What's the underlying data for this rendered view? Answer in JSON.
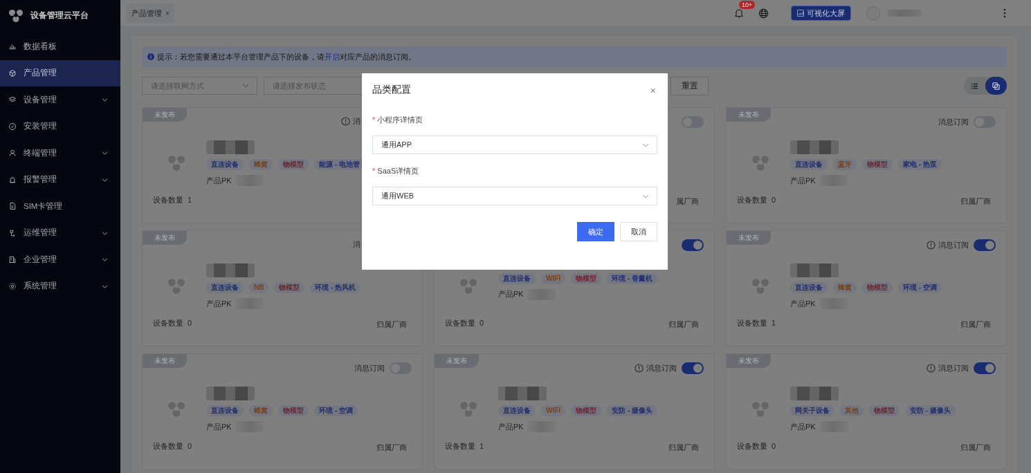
{
  "sidebar": {
    "title": "设备管理云平台",
    "items": [
      {
        "label": "数据看板",
        "selected": false,
        "expandable": false
      },
      {
        "label": "产品管理",
        "selected": true,
        "expandable": false
      },
      {
        "label": "设备管理",
        "selected": false,
        "expandable": true
      },
      {
        "label": "安装管理",
        "selected": false,
        "expandable": false
      },
      {
        "label": "终端管理",
        "selected": false,
        "expandable": true
      },
      {
        "label": "报警管理",
        "selected": false,
        "expandable": true
      },
      {
        "label": "SIM卡管理",
        "selected": false,
        "expandable": false
      },
      {
        "label": "运维管理",
        "selected": false,
        "expandable": true
      },
      {
        "label": "企业管理",
        "selected": false,
        "expandable": true
      },
      {
        "label": "系统管理",
        "selected": false,
        "expandable": true
      }
    ]
  },
  "header": {
    "tabs": [
      {
        "label": "产品管理",
        "close": "×",
        "selected": true
      }
    ],
    "notification_badge": "10+",
    "dashboard_button": "可视化大屏"
  },
  "notice": {
    "prefix": "提示：若您需要通过本平台管理产品下的设备，请",
    "link": "开启",
    "suffix": "对应产品的消息订阅。"
  },
  "filters": [
    {
      "placeholder": "请选择联网方式",
      "caret": true
    },
    {
      "placeholder": "请选择发布状态"
    }
  ],
  "reset_button": "重置",
  "view_modes": [
    {
      "selected": false
    },
    {
      "selected": true
    }
  ],
  "cards": [
    {
      "status": "未发布",
      "subscription": {
        "label": "消",
        "info_icon": true
      },
      "blurred_name": true,
      "tags": [
        {
          "text": "直连设备",
          "color": "#1e2e6e"
        },
        {
          "text": "蜂窝",
          "color": "#74421e"
        },
        {
          "text": "物模型",
          "color": "#6d2430"
        },
        {
          "text": "能源 - 电池管",
          "color": "#1e2e6e"
        }
      ],
      "pk_label": "产品PK",
      "count": {
        "label": "设备数量",
        "value": "1"
      }
    },
    {
      "subscription": {
        "info_icon": false,
        "toggle": {
          "on": false
        }
      },
      "vendor": "属厂商"
    },
    {
      "status": "未发布",
      "subscription": {
        "label": "消息订阅",
        "info_icon": false,
        "toggle": {
          "on": false
        }
      },
      "blurred_name": true,
      "tags": [
        {
          "text": "直连设备",
          "color": "#1e2e6e"
        },
        {
          "text": "蓝牙",
          "color": "#74421e"
        },
        {
          "text": "物模型",
          "color": "#6d2430"
        },
        {
          "text": "家电 - 热泵",
          "color": "#1e2e6e"
        }
      ],
      "pk_label": "产品PK",
      "count": {
        "label": "设备数量",
        "value": "0"
      },
      "vendor": "归属厂商"
    },
    {
      "status": "未发布",
      "subscription": {
        "label": "消",
        "info_icon": false
      },
      "blurred_name": true,
      "tags": [
        {
          "text": "直连设备",
          "color": "#1e2e6e"
        },
        {
          "text": "NB",
          "color": "#74421e"
        },
        {
          "text": "物模型",
          "color": "#6d2430"
        },
        {
          "text": "环境 - 热风机",
          "color": "#1e2e6e"
        }
      ],
      "pk_label": "产品PK",
      "count": {
        "label": "设备数量",
        "value": "0"
      },
      "vendor": "归属厂商"
    },
    {
      "subscription": {
        "info_icon": false,
        "toggle": {
          "on": true
        }
      },
      "blurred_name": false,
      "tags": [
        {
          "text": "直连设备",
          "color": "#1e2e6e"
        },
        {
          "text": "WIFI",
          "color": "#74421e"
        },
        {
          "text": "物模型",
          "color": "#6d2430"
        },
        {
          "text": "环境 - 香薰机",
          "color": "#1e2e6e"
        }
      ],
      "pk_label": "产品PK",
      "count": {
        "label": "设备数量",
        "value": "0"
      },
      "vendor": "归属厂商"
    },
    {
      "status": "未发布",
      "subscription": {
        "label": "消息订阅",
        "info_icon": true,
        "toggle": {
          "on": true
        }
      },
      "blurred_name": true,
      "tags": [
        {
          "text": "直连设备",
          "color": "#1e2e6e"
        },
        {
          "text": "蜂窝",
          "color": "#74421e"
        },
        {
          "text": "物模型",
          "color": "#6d2430"
        },
        {
          "text": "环境 - 空调",
          "color": "#1e2e6e"
        }
      ],
      "pk_label": "产品PK",
      "count": {
        "label": "设备数量",
        "value": "1"
      },
      "vendor": "归属厂商"
    },
    {
      "status": "未发布",
      "subscription": {
        "label": "消息订阅",
        "info_icon": false,
        "toggle": {
          "on": false
        }
      },
      "blurred_name": true,
      "tags": [
        {
          "text": "直连设备",
          "color": "#1e2e6e"
        },
        {
          "text": "蜂窝",
          "color": "#74421e"
        },
        {
          "text": "物模型",
          "color": "#6d2430"
        },
        {
          "text": "环境 - 空调",
          "color": "#1e2e6e"
        }
      ],
      "pk_label": "产品PK",
      "count": {
        "label": "设备数量",
        "value": "0"
      },
      "vendor": "归属厂商"
    },
    {
      "status": "未发布",
      "subscription": {
        "label": "消息订阅",
        "info_icon": true,
        "toggle": {
          "on": true
        }
      },
      "blurred_name": true,
      "tags": [
        {
          "text": "直连设备",
          "color": "#1e2e6e"
        },
        {
          "text": "WIFI",
          "color": "#74421e"
        },
        {
          "text": "物模型",
          "color": "#6d2430"
        },
        {
          "text": "安防 - 摄像头",
          "color": "#1e2e6e"
        }
      ],
      "pk_label": "产品PK",
      "count": {
        "label": "设备数量",
        "value": "1"
      },
      "vendor": "归属厂商"
    },
    {
      "status": "未发布",
      "subscription": {
        "label": "消息订阅",
        "info_icon": true,
        "toggle": {
          "on": true
        }
      },
      "blurred_name": true,
      "tags": [
        {
          "text": "网关子设备",
          "color": "#1e2e6e"
        },
        {
          "text": "其他",
          "color": "#74421e"
        },
        {
          "text": "物模型",
          "color": "#6d2430"
        },
        {
          "text": "安防 - 摄像头",
          "color": "#1e2e6e"
        }
      ],
      "pk_label": "产品PK",
      "count": {
        "label": "设备数量",
        "value": "0"
      },
      "vendor": "归属厂商"
    }
  ],
  "dialog": {
    "title": "品类配置",
    "close": "×",
    "fields": [
      {
        "required_mark": "*",
        "label": "小程序详情页",
        "value": "通用APP"
      },
      {
        "required_mark": "*",
        "label": "SaaS详情页",
        "value": "通用WEB"
      }
    ],
    "buttons": [
      {
        "label": "确定",
        "primary": true
      },
      {
        "label": "取消",
        "primary": false
      }
    ]
  }
}
